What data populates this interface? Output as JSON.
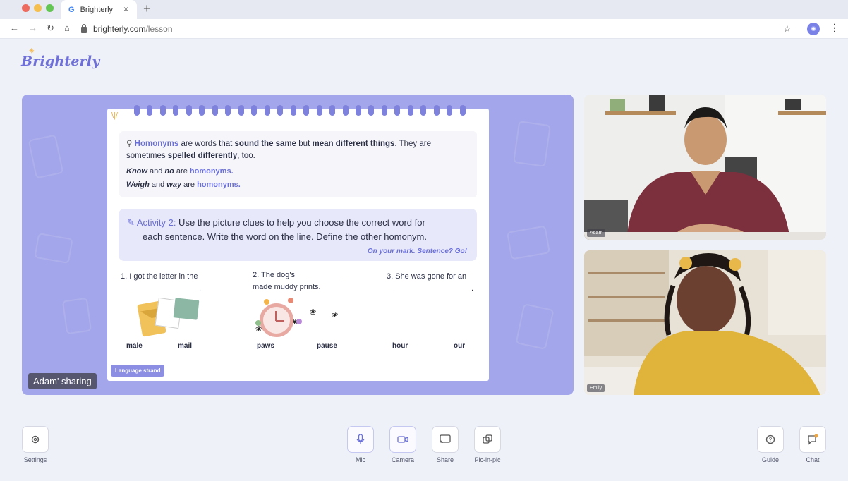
{
  "browser": {
    "tab_title": "Brighterly",
    "tab_close": "×",
    "new_tab": "+",
    "url_host": "brighterly.com",
    "url_path": "/lesson",
    "traffic_colors": [
      "#ed6a5e",
      "#f5bf4f",
      "#62c554"
    ]
  },
  "app": {
    "logo": "Brighterly",
    "brand_color": "#6e6fd9"
  },
  "stage": {
    "sharing_label": "Adam' sharing",
    "worksheet": {
      "definition": {
        "word": "Homonyms",
        "text1": " are words that ",
        "bold1": "sound the same",
        "text2": " but ",
        "bold2": "mean different things",
        "text3": ". They are",
        "line2_text": "sometimes ",
        "line2_bold": "spelled differently",
        "line2_end": ", too.",
        "ex1_a": "Know",
        "ex1_and": " and ",
        "ex1_b": "no",
        "ex1_are": " are ",
        "ex1_hl": "homonyms.",
        "ex2_a": "Weigh",
        "ex2_and": " and ",
        "ex2_b": "way",
        "ex2_are": " are ",
        "ex2_hl": "homonyms."
      },
      "activity": {
        "label": "Activity 2:",
        "line1": " Use the picture clues to help you choose the correct word for",
        "line2": "each sentence. Write the word on the line. Define the other homonym.",
        "tagline": "On your mark. Sentence? Go!"
      },
      "questions": [
        {
          "text": "1. I got the letter in the",
          "end": ".",
          "words": [
            "male",
            "mail"
          ]
        },
        {
          "text": "2. The dog's",
          "line2": "made muddy prints.",
          "words": [
            "paws",
            "pause"
          ]
        },
        {
          "text": "3. She was gone for an",
          "end": ".",
          "words": [
            "hour",
            "our"
          ]
        }
      ],
      "strand": "Language strand"
    }
  },
  "videos": [
    {
      "name": "Adam"
    },
    {
      "name": "Emily"
    }
  ],
  "toolbar": {
    "settings": "Settings",
    "mic": "Mic",
    "camera": "Camera",
    "share": "Share",
    "pip": "Pic-in-pic",
    "guide": "Guide",
    "chat": "Chat"
  }
}
